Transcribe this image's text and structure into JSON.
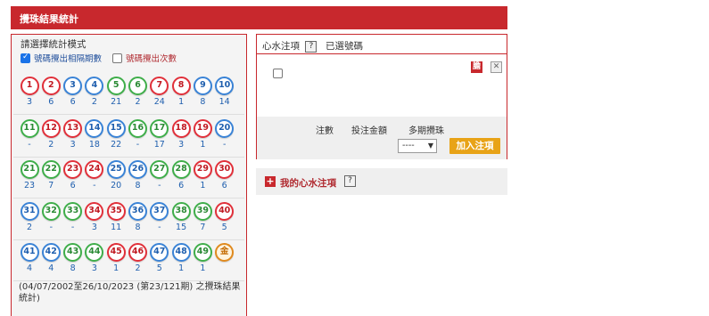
{
  "header": {
    "title": "攪珠結果統計"
  },
  "options": {
    "title": "請選擇統計模式",
    "opt1_label": "號碼攪出相隔期數",
    "opt1_checked": true,
    "opt2_label": "號碼攪出次數",
    "opt2_checked": false
  },
  "balls": [
    [
      {
        "n": "1",
        "c": "red",
        "v": "3"
      },
      {
        "n": "2",
        "c": "red",
        "v": "6"
      },
      {
        "n": "3",
        "c": "blue",
        "v": "6"
      },
      {
        "n": "4",
        "c": "blue",
        "v": "2"
      },
      {
        "n": "5",
        "c": "green",
        "v": "21"
      },
      {
        "n": "6",
        "c": "green",
        "v": "2"
      },
      {
        "n": "7",
        "c": "red",
        "v": "24"
      },
      {
        "n": "8",
        "c": "red",
        "v": "1"
      },
      {
        "n": "9",
        "c": "blue",
        "v": "8"
      },
      {
        "n": "10",
        "c": "blue",
        "v": "14"
      }
    ],
    [
      {
        "n": "11",
        "c": "green",
        "v": "-"
      },
      {
        "n": "12",
        "c": "red",
        "v": "2"
      },
      {
        "n": "13",
        "c": "red",
        "v": "3"
      },
      {
        "n": "14",
        "c": "blue",
        "v": "18"
      },
      {
        "n": "15",
        "c": "blue",
        "v": "22"
      },
      {
        "n": "16",
        "c": "green",
        "v": "-"
      },
      {
        "n": "17",
        "c": "green",
        "v": "17"
      },
      {
        "n": "18",
        "c": "red",
        "v": "3"
      },
      {
        "n": "19",
        "c": "red",
        "v": "1"
      },
      {
        "n": "20",
        "c": "blue",
        "v": "-"
      }
    ],
    [
      {
        "n": "21",
        "c": "green",
        "v": "23"
      },
      {
        "n": "22",
        "c": "green",
        "v": "7"
      },
      {
        "n": "23",
        "c": "red",
        "v": "6"
      },
      {
        "n": "24",
        "c": "red",
        "v": "-"
      },
      {
        "n": "25",
        "c": "blue",
        "v": "20"
      },
      {
        "n": "26",
        "c": "blue",
        "v": "8"
      },
      {
        "n": "27",
        "c": "green",
        "v": "-"
      },
      {
        "n": "28",
        "c": "green",
        "v": "6"
      },
      {
        "n": "29",
        "c": "red",
        "v": "1"
      },
      {
        "n": "30",
        "c": "red",
        "v": "6"
      }
    ],
    [
      {
        "n": "31",
        "c": "blue",
        "v": "2"
      },
      {
        "n": "32",
        "c": "green",
        "v": "-"
      },
      {
        "n": "33",
        "c": "green",
        "v": "-"
      },
      {
        "n": "34",
        "c": "red",
        "v": "3"
      },
      {
        "n": "35",
        "c": "red",
        "v": "11"
      },
      {
        "n": "36",
        "c": "blue",
        "v": "8"
      },
      {
        "n": "37",
        "c": "blue",
        "v": "-"
      },
      {
        "n": "38",
        "c": "green",
        "v": "15"
      },
      {
        "n": "39",
        "c": "green",
        "v": "7"
      },
      {
        "n": "40",
        "c": "red",
        "v": "5"
      }
    ],
    [
      {
        "n": "41",
        "c": "blue",
        "v": "4"
      },
      {
        "n": "42",
        "c": "blue",
        "v": "4"
      },
      {
        "n": "43",
        "c": "green",
        "v": "8"
      },
      {
        "n": "44",
        "c": "green",
        "v": "3"
      },
      {
        "n": "45",
        "c": "red",
        "v": "1"
      },
      {
        "n": "46",
        "c": "red",
        "v": "2"
      },
      {
        "n": "47",
        "c": "blue",
        "v": "5"
      },
      {
        "n": "48",
        "c": "blue",
        "v": "1"
      },
      {
        "n": "49",
        "c": "green",
        "v": "1"
      },
      {
        "n": "金",
        "c": "gold",
        "v": ""
      }
    ]
  ],
  "footnote": "(04/07/2002至26/10/2023 (第23/121期) 之攪珠結果統計)",
  "right_panel": {
    "tab1": "心水注項",
    "help": "?",
    "tab2": "已選號碼",
    "bank_icon": "膽",
    "close_icon": "✕",
    "label_bets": "注數",
    "label_amount": "投注金額",
    "label_multi": "多期攪珠",
    "select_value": "----",
    "add_button": "加入注項"
  },
  "fav": {
    "label": "我的心水注項",
    "help": "?"
  },
  "colors": {
    "brand": "#c8282d",
    "accent": "#e8a317"
  }
}
